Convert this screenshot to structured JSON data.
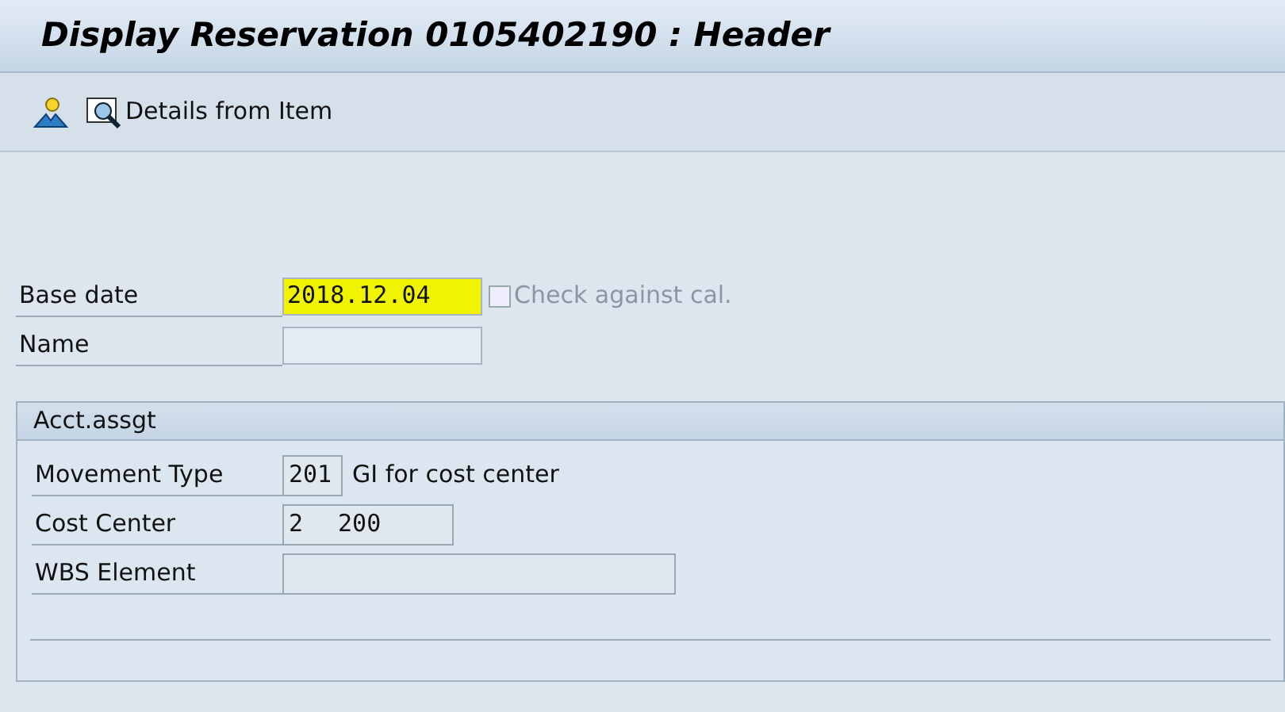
{
  "window": {
    "title": "Display Reservation 0105402190 : Header"
  },
  "toolbar": {
    "items": [
      {
        "kind": "icon"
      },
      {
        "kind": "labeled",
        "label": "Details from Item"
      }
    ]
  },
  "header_fields": [
    {
      "label": "Base date",
      "value": "2018.12.04",
      "highlighted": true,
      "checkbox": {
        "label": "Check against cal.",
        "checked": false,
        "disabled": true
      }
    },
    {
      "label": "Name",
      "highlighted": false
    }
  ],
  "group": {
    "title": "Acct.assgt",
    "fields": [
      {
        "label": "Movement Type",
        "value": "201",
        "description": "GI for cost center"
      },
      {
        "label": "Cost Center",
        "value_start": "2",
        "value_end": "200"
      },
      {
        "label": "WBS Element"
      }
    ]
  }
}
